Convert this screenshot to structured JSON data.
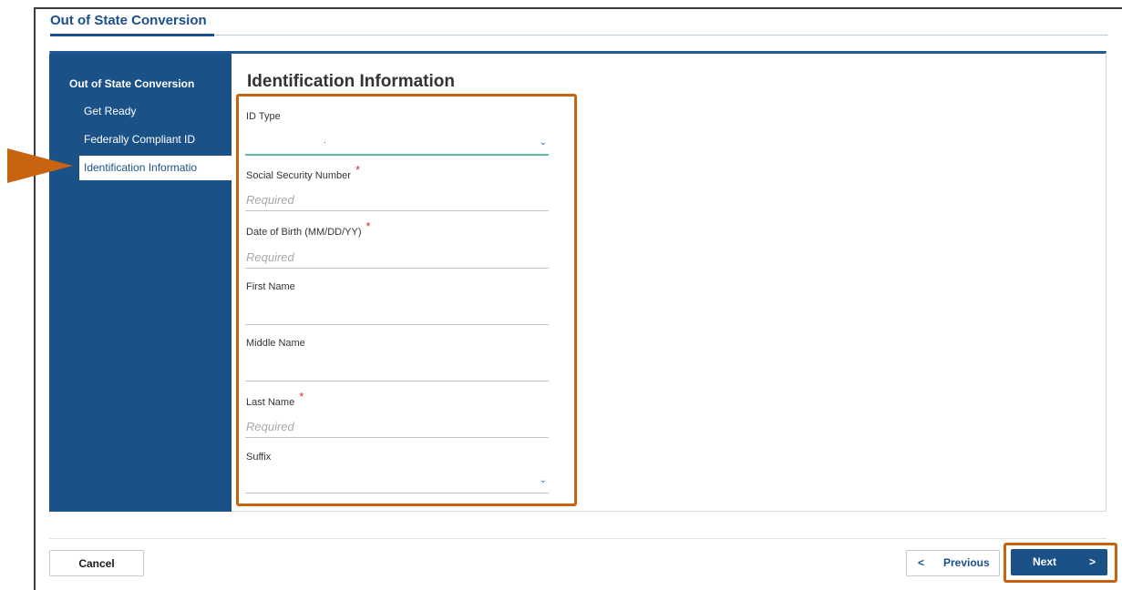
{
  "header": {
    "title": "Out of State Conversion"
  },
  "sidebar": {
    "heading": "Out of State Conversion",
    "items": [
      {
        "label": "Get Ready"
      },
      {
        "label": "Federally Compliant ID"
      },
      {
        "label": "Identification Informatio"
      }
    ]
  },
  "form": {
    "heading": "Identification Information",
    "fields": {
      "id_type": {
        "label": "ID Type",
        "value": "."
      },
      "ssn": {
        "label": "Social Security Number",
        "placeholder": "Required",
        "required_mark": "*"
      },
      "dob": {
        "label": "Date of Birth (MM/DD/YY)",
        "placeholder": "Required",
        "required_mark": "*"
      },
      "first_name": {
        "label": "First Name"
      },
      "middle_name": {
        "label": "Middle Name"
      },
      "last_name": {
        "label": "Last Name",
        "placeholder": "Required",
        "required_mark": "*"
      },
      "suffix": {
        "label": "Suffix"
      }
    }
  },
  "footer": {
    "cancel_label": "Cancel",
    "previous_label": "Previous",
    "previous_arrow": "<",
    "next_label": "Next",
    "next_arrow": ">"
  },
  "icons": {
    "chevron": "⌄",
    "callout_arrow": "triangle-right",
    "accent_orange": "#c8640f",
    "sidebar_blue": "#1a5288"
  }
}
